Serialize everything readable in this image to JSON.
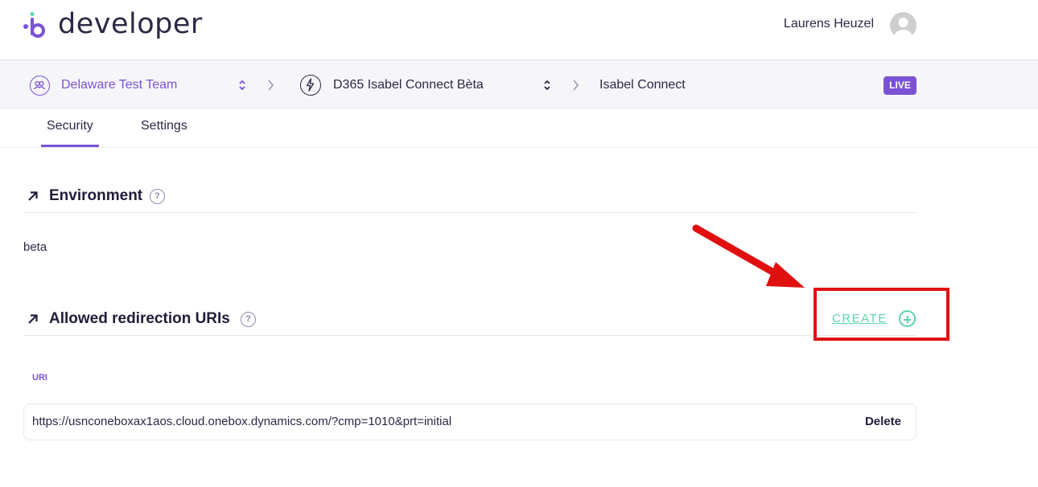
{
  "header": {
    "brand": "developer",
    "user_name": "Laurens Heuzel"
  },
  "breadcrumb": {
    "team": "Delaware Test Team",
    "app": "D365 Isabel Connect Bèta",
    "page": "Isabel Connect",
    "badge": "LIVE"
  },
  "tabs": [
    {
      "label": "Security",
      "active": true
    },
    {
      "label": "Settings",
      "active": false
    }
  ],
  "environment": {
    "title": "Environment",
    "help": "?",
    "value": "beta"
  },
  "redirects": {
    "title": "Allowed redirection URIs",
    "help": "?",
    "create_label": "CREATE",
    "column_header": "URI",
    "rows": [
      {
        "uri": "https://usnconeboxax1aos.cloud.onebox.dynamics.com/?cmp=1010&prt=initial",
        "action": "Delete"
      }
    ]
  },
  "colors": {
    "accent": "#7a52d4",
    "create": "#5fd3a8",
    "annotation": "#e01010"
  }
}
